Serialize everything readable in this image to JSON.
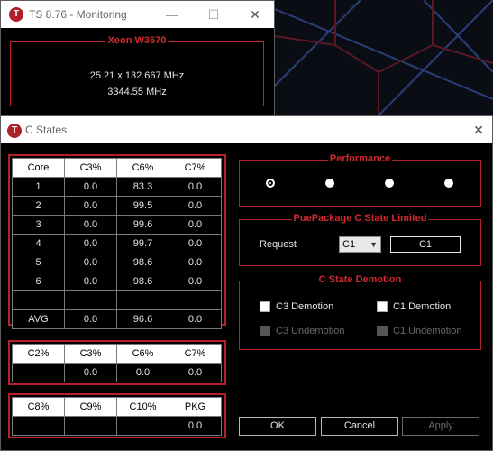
{
  "monitor_window": {
    "title": "TS 8.76 - Monitoring",
    "icon": "T",
    "cpu_name": "Xeon W3670",
    "multiplier_line": "25.21 x 132.667 MHz",
    "frequency_line": "3344.55 MHz"
  },
  "cstates_window": {
    "title": "C States",
    "icon": "T",
    "core_table": {
      "headers": [
        "Core",
        "C3%",
        "C6%",
        "C7%"
      ],
      "rows": [
        [
          "1",
          "0.0",
          "83.3",
          "0.0"
        ],
        [
          "2",
          "0.0",
          "99.5",
          "0.0"
        ],
        [
          "3",
          "0.0",
          "99.6",
          "0.0"
        ],
        [
          "4",
          "0.0",
          "99.7",
          "0.0"
        ],
        [
          "5",
          "0.0",
          "98.6",
          "0.0"
        ],
        [
          "6",
          "0.0",
          "98.6",
          "0.0"
        ],
        [
          "",
          "",
          "",
          ""
        ],
        [
          "AVG",
          "0.0",
          "96.6",
          "0.0"
        ]
      ]
    },
    "package_table": {
      "headers": [
        "C2%",
        "C3%",
        "C6%",
        "C7%"
      ],
      "rows": [
        [
          "",
          "0.0",
          "0.0",
          "0.0"
        ]
      ]
    },
    "package_table2": {
      "headers": [
        "C8%",
        "C9%",
        "C10%",
        "PKG"
      ],
      "rows": [
        [
          "",
          "",
          "",
          "0.0"
        ]
      ]
    },
    "performance": {
      "legend": "Performance"
    },
    "package_limit": {
      "legend": "Package C State Limit",
      "legend_overlap": "Pue",
      "legend_overlap2": "ed",
      "request_label": "Request",
      "select_value": "C1",
      "current_value": "C1"
    },
    "demotion": {
      "legend": "C State Demotion",
      "c3_demotion": "C3 Demotion",
      "c1_demotion": "C1 Demotion",
      "c3_undemotion": "C3 Undemotion",
      "c1_undemotion": "C1 Undemotion"
    },
    "buttons": {
      "ok": "OK",
      "cancel": "Cancel",
      "apply": "Apply"
    }
  }
}
